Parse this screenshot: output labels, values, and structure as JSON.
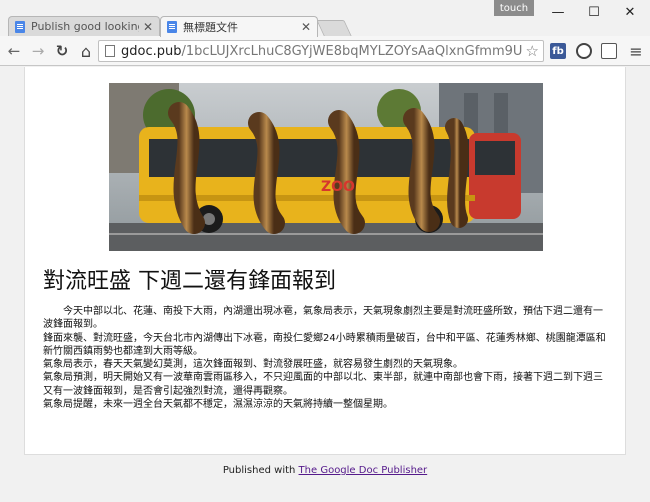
{
  "browser": {
    "tabs": [
      {
        "label": "Publish good looking Go",
        "active": false
      },
      {
        "label": "無標題文件",
        "active": true
      }
    ],
    "touch_badge": "touch",
    "window_controls": {
      "minimize": "—",
      "maximize": "☐",
      "close": "✕"
    },
    "nav": {
      "back": "←",
      "forward": "→",
      "reload": "↻",
      "home": "⌂"
    },
    "url_host": "gdoc.pub",
    "url_path": "/1bcLUJXrcLhuC8GYjWE8bqMYLZOYsAaQlxnGfmm9U",
    "extensions": [
      {
        "name": "fb-icon",
        "label": "fb",
        "color": "#3b5998"
      },
      {
        "name": "compass-icon",
        "label": "",
        "color": "#444444"
      },
      {
        "name": "share-icon",
        "label": "",
        "color": "#555555"
      }
    ],
    "menu_glyph": "≡",
    "star_glyph": "☆"
  },
  "document": {
    "title": "對流旺盛 下週二還有鋒面報到",
    "paragraphs": [
      "今天中部以北、花蓮、南投下大雨，內湖還出現冰雹，氣象局表示，天氣現象劇烈主要是對流旺盛所致，預估下週二還有一波鋒面報到。",
      "鋒面來襲、對流旺盛，今天台北市內湖傳出下冰雹，南投仁愛鄉24小時累積雨量破百，台中和平區、花蓮秀林鄉、桃園龍潭區和新竹關西鎮雨勢也都達到大雨等級。",
      "氣象局表示，春天天氣變幻莫測，這次鋒面報到、對流發展旺盛，就容易發生劇烈的天氣現象。",
      "氣象局預測，明天開始又有一波華南雲雨區移入，不只迎風面的中部以北、東半部，就連中南部也會下雨，接著下週二到下週三又有一波鋒面報到，是否會引起強烈對流，還得再觀察。",
      "氣象局提醒，未來一週全台天氣都不穩定，濕濕涼涼的天氣將持續一整個星期。"
    ],
    "hero_image_logo": "ZOO"
  },
  "footer": {
    "prefix": "Published with ",
    "link_label": "The Google Doc Publisher"
  }
}
